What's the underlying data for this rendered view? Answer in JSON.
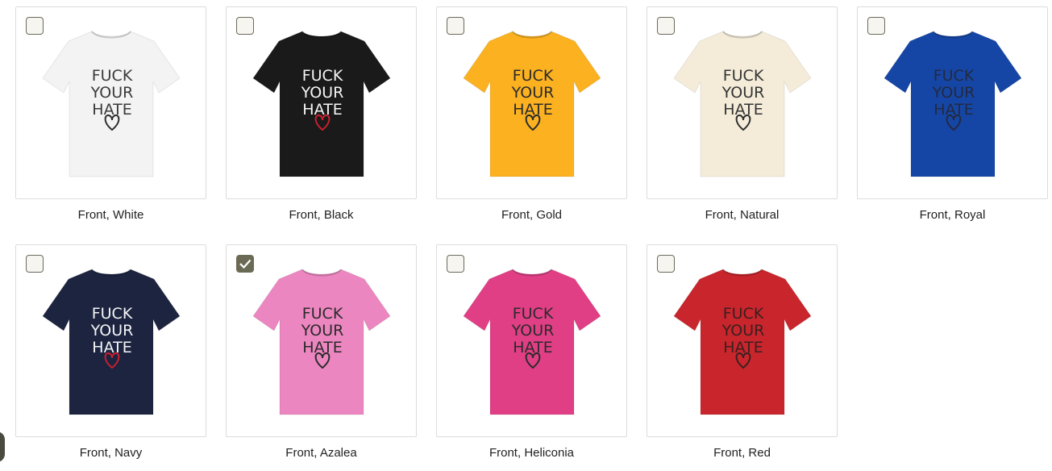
{
  "products": [
    {
      "caption": "Front, White",
      "color": "#f3f3f3",
      "print_color": "#3a3a3a",
      "heart_color": "#2e2e2e",
      "checked": false
    },
    {
      "caption": "Front, Black",
      "color": "#1a1a1a",
      "print_color": "#f5f5f5",
      "heart_color": "#c8202f",
      "checked": false
    },
    {
      "caption": "Front, Gold",
      "color": "#fbb120",
      "print_color": "#2b2b2b",
      "heart_color": "#2b2b2b",
      "checked": false
    },
    {
      "caption": "Front, Natural",
      "color": "#f4ecd9",
      "print_color": "#343434",
      "heart_color": "#2e2e2e",
      "checked": false
    },
    {
      "caption": "Front, Royal",
      "color": "#1646a5",
      "print_color": "#222a40",
      "heart_color": "#222a40",
      "checked": false
    },
    {
      "caption": "Front, Navy",
      "color": "#1c2440",
      "print_color": "#f5f5f5",
      "heart_color": "#c8202f",
      "checked": false
    },
    {
      "caption": "Front, Azalea",
      "color": "#ec86c0",
      "print_color": "#2b2b2b",
      "heart_color": "#2b2b2b",
      "checked": true
    },
    {
      "caption": "Front, Heliconia",
      "color": "#e03f85",
      "print_color": "#2b2b2b",
      "heart_color": "#2b2b2b",
      "checked": false
    },
    {
      "caption": "Front, Red",
      "color": "#c8252c",
      "print_color": "#3b2020",
      "heart_color": "#3b2020",
      "checked": false
    }
  ],
  "print_lines": [
    "FUCK",
    "YOUR",
    "HATE"
  ],
  "accent_checkbox": "#6b6a54"
}
